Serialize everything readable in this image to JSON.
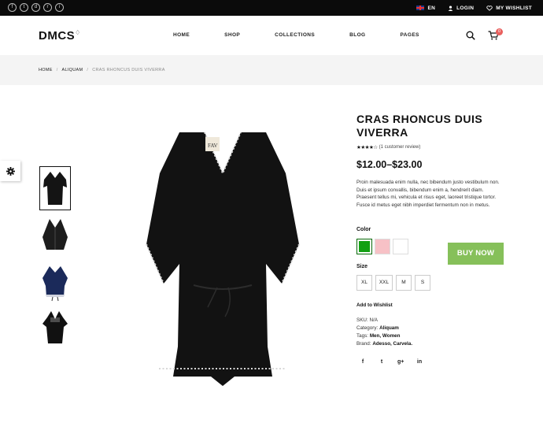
{
  "topbar": {
    "social_icons": [
      "facebook-icon",
      "twitter-icon",
      "dribbble-icon",
      "rss-icon",
      "instagram-icon"
    ],
    "social_glyphs": [
      "f",
      "t",
      "d",
      "r",
      "i"
    ],
    "language": "EN",
    "login": "LOGIN",
    "wishlist": "MY WISHLIST"
  },
  "header": {
    "logo": "DMCS",
    "nav": [
      "HOME",
      "SHOP",
      "COLLECTIONS",
      "BLOG",
      "PAGES"
    ],
    "cart_count": "0"
  },
  "breadcrumb": [
    "HOME",
    "ALIQUAM",
    "CRAS RHONCUS DUIS VIVERRA"
  ],
  "product": {
    "title": "CRAS RHONCUS DUIS VIVERRA",
    "rating_stars": 4,
    "rating_text": "(1 customer review)",
    "price": "$12.00–$23.00",
    "description": "Proin malesuada enim nulla, nec bibendum justo vestibulum non. Duis et ipsum convallis, bibendum enim a, hendrerit diam. Praesent tellus mi, vehicula et risus eget, laoreet tristique tortor. Fusce id metus eget nibh imperdiet fermentum non in metus.",
    "color_label": "Color",
    "colors": [
      "#13a013",
      "#f7c1c6",
      "#ffffff"
    ],
    "buy_label": "BUY NOW",
    "size_label": "Size",
    "sizes": [
      "XL",
      "XXL",
      "M",
      "S"
    ],
    "wishlist_label": "Add to Wishlist",
    "sku_label": "SKU:",
    "sku": "N/A",
    "category_label": "Category:",
    "category": "Aliquam",
    "tags_label": "Tags:",
    "tags": "Men, Women",
    "brand_label": "Brand:",
    "brand": "Adesso, Carvela.",
    "share": [
      "f",
      "t",
      "g+",
      "in"
    ]
  },
  "colors": {
    "accent": "#86c05a",
    "badge": "#e9605e",
    "topbar": "#0b0b0b"
  }
}
